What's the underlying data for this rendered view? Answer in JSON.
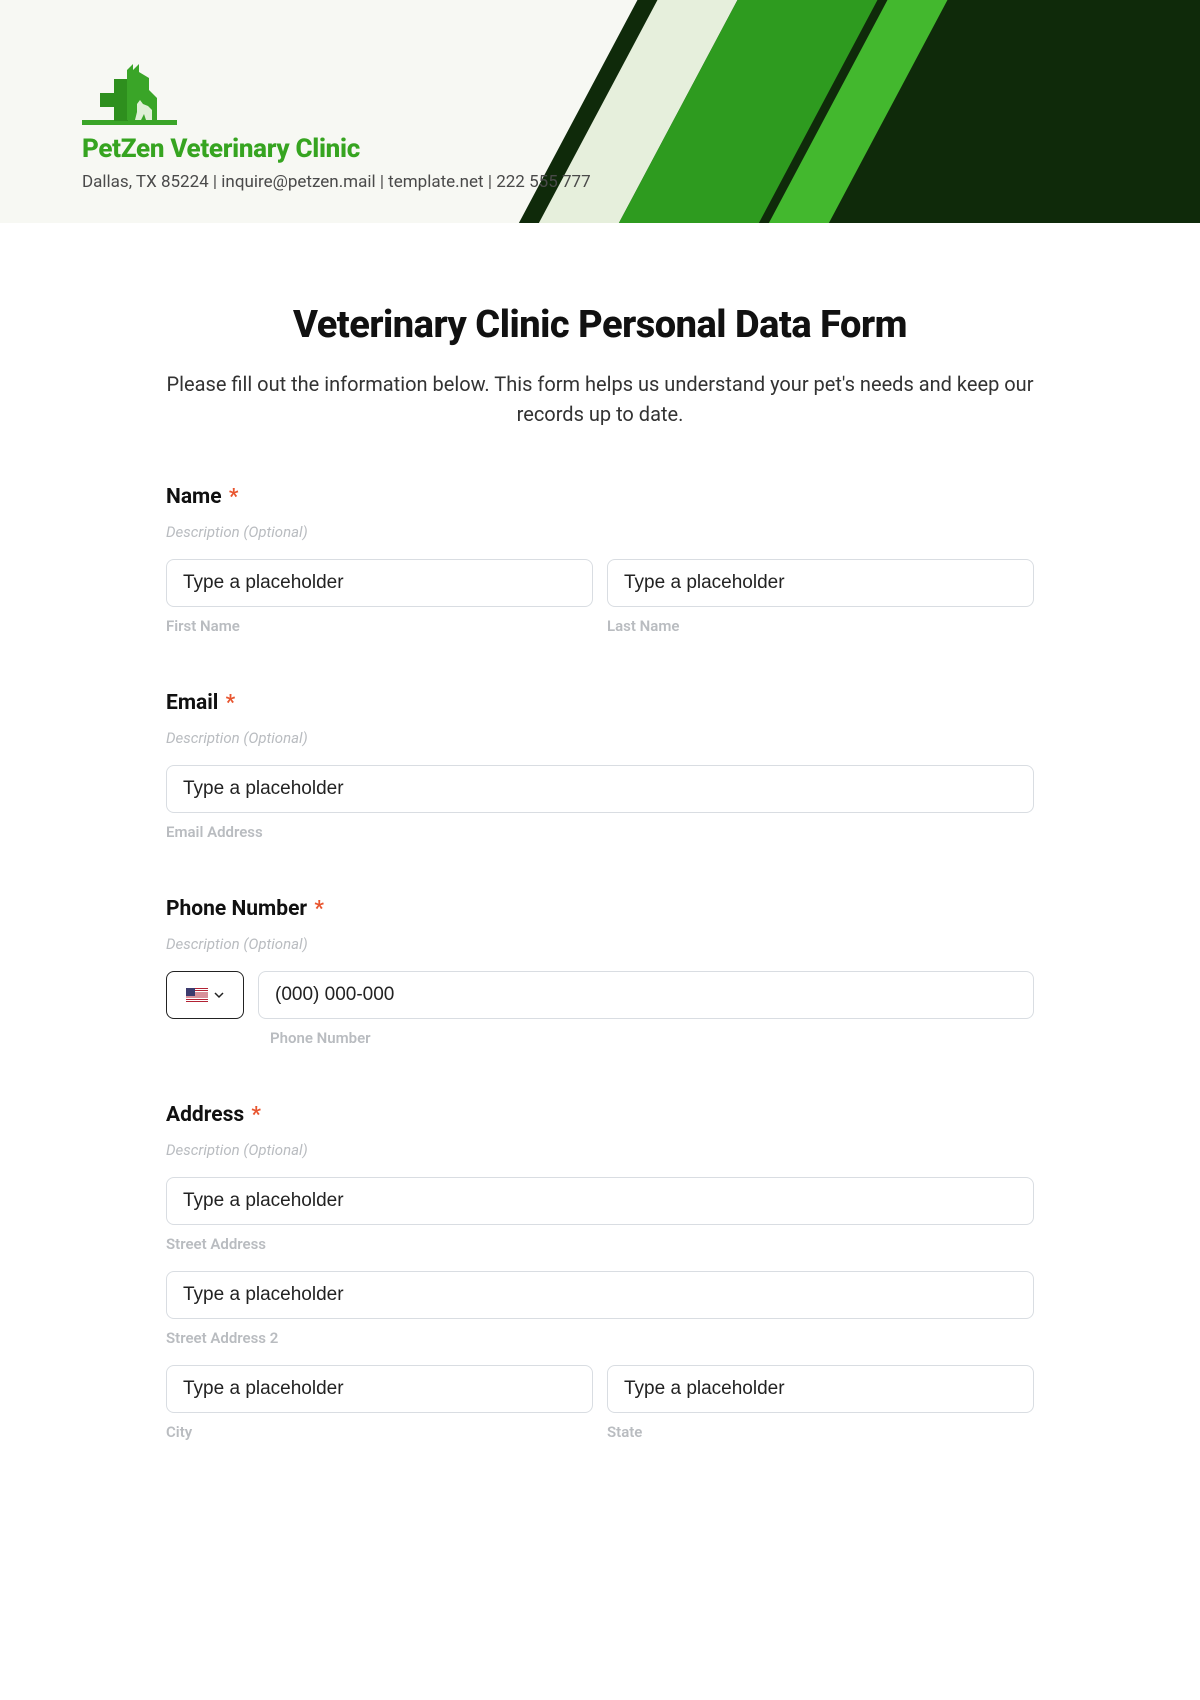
{
  "header": {
    "company_name": "PetZen Veterinary Clinic",
    "subline": "Dallas, TX 85224 | inquire@petzen.mail | template.net | 222 555 777"
  },
  "form": {
    "title": "Veterinary Clinic Personal Data Form",
    "description": "Please fill out the information below. This form helps us understand your pet's needs and keep our records up to date.",
    "required_mark": "*",
    "hint_text": "Description (Optional)",
    "placeholder": "Type a placeholder",
    "fields": {
      "name": {
        "label": "Name",
        "first_sub": "First Name",
        "last_sub": "Last Name"
      },
      "email": {
        "label": "Email",
        "sub": "Email Address"
      },
      "phone": {
        "label": "Phone Number",
        "placeholder": "(000) 000-000",
        "sub": "Phone Number"
      },
      "address": {
        "label": "Address",
        "street_sub": "Street Address",
        "street2_sub": "Street Address 2",
        "city_sub": "City",
        "state_sub": "State"
      }
    }
  }
}
